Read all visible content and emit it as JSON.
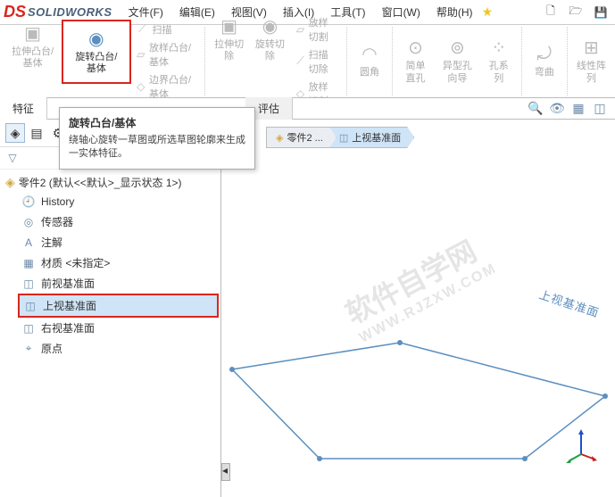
{
  "app": {
    "logo_text": "SOLIDWORKS"
  },
  "menu": {
    "file": "文件(F)",
    "edit": "编辑(E)",
    "view": "视图(V)",
    "insert": "插入(I)",
    "tools": "工具(T)",
    "window": "窗口(W)",
    "help": "帮助(H)"
  },
  "ribbon": {
    "extrude": "拉伸凸台/基体",
    "revolve": "旋转凸台/基体",
    "sweep": "扫描",
    "loft": "放样凸台/基体",
    "boundary": "边界凸台/基体",
    "extrude_cut": "拉伸切除",
    "revolve_cut": "旋转切除",
    "loft_cut": "放样切割",
    "sweep_cut": "扫描切除",
    "boundary_cut": "放样切割",
    "fillet": "圆角",
    "simple_hole": "简单直孔",
    "hole_wizard": "异型孔向导",
    "hole_series": "孔系列",
    "wrap": "弯曲",
    "linear_pattern": "线性阵列"
  },
  "tabs": {
    "feature": "特征",
    "evaluate": "评估"
  },
  "tooltip": {
    "title": "旋转凸台/基体",
    "desc": "绕轴心旋转一草图或所选草图轮廓来生成一实体特征。"
  },
  "tree": {
    "root": "零件2  (默认<<默认>_显示状态 1>)",
    "items": [
      {
        "label": "History",
        "icon": "history"
      },
      {
        "label": "传感器",
        "icon": "sensor"
      },
      {
        "label": "注解",
        "icon": "annotation"
      },
      {
        "label": "材质 <未指定>",
        "icon": "material"
      },
      {
        "label": "前视基准面",
        "icon": "plane"
      },
      {
        "label": "上视基准面",
        "icon": "plane",
        "highlighted": true
      },
      {
        "label": "右视基准面",
        "icon": "plane"
      },
      {
        "label": "原点",
        "icon": "origin"
      }
    ]
  },
  "breadcrumb": {
    "seg1": "零件2 ...",
    "seg2": "上视基准面"
  },
  "viewport": {
    "plane_label": "上视基准面",
    "watermark": "软件自学网",
    "watermark_url": "WWW.RJZXW.COM"
  }
}
